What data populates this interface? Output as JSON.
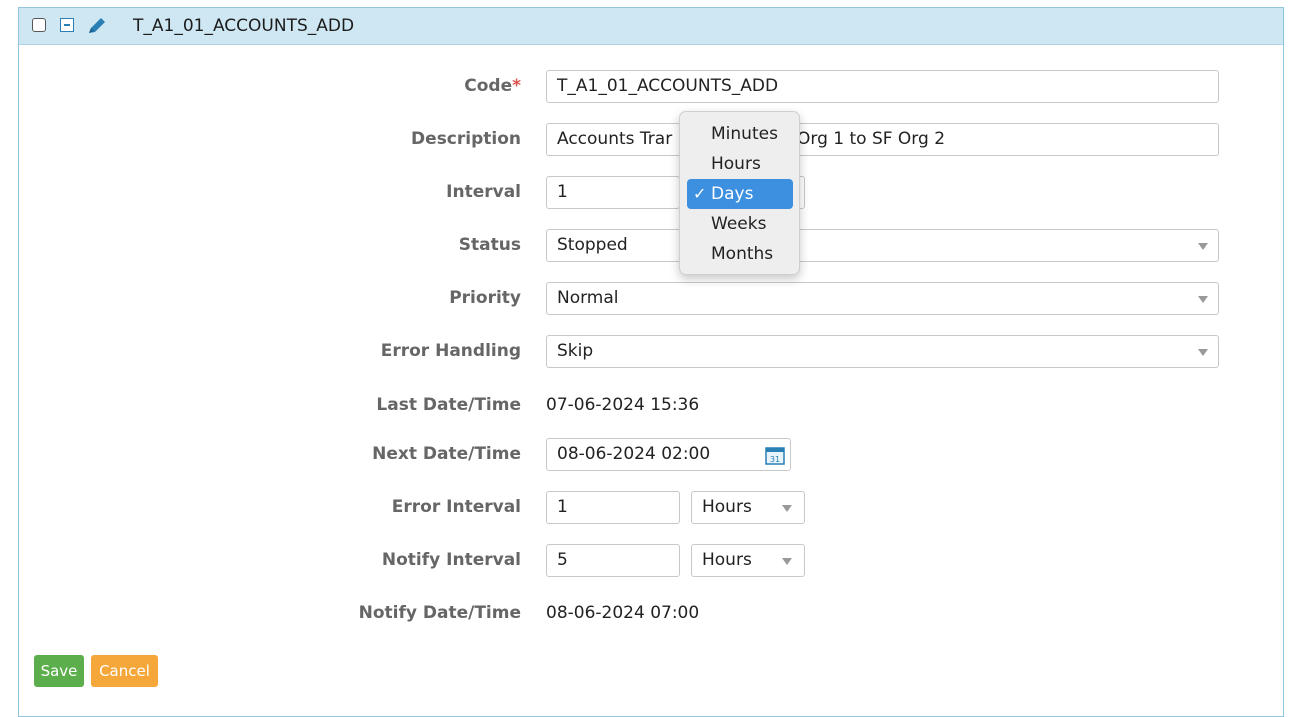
{
  "header": {
    "title": "T_A1_01_ACCOUNTS_ADD"
  },
  "form": {
    "code": {
      "label": "Code",
      "required_mark": "*",
      "value": "T_A1_01_ACCOUNTS_ADD"
    },
    "description": {
      "label": "Description",
      "value_left": "Accounts Trar",
      "value_right": "Org 1 to SF Org 2"
    },
    "interval": {
      "label": "Interval",
      "value": "1"
    },
    "status": {
      "label": "Status",
      "value": "Stopped"
    },
    "priority": {
      "label": "Priority",
      "value": "Normal"
    },
    "error_handling": {
      "label": "Error Handling",
      "value": "Skip"
    },
    "last_datetime": {
      "label": "Last Date/Time",
      "value": "07-06-2024 15:36"
    },
    "next_datetime": {
      "label": "Next Date/Time",
      "value": "08-06-2024 02:00",
      "calendar_day": "31"
    },
    "error_interval": {
      "label": "Error Interval",
      "value": "1",
      "unit": "Hours"
    },
    "notify_interval": {
      "label": "Notify Interval",
      "value": "5",
      "unit": "Hours"
    },
    "notify_datetime": {
      "label": "Notify Date/Time",
      "value": "08-06-2024 07:00"
    }
  },
  "buttons": {
    "save": "Save",
    "cancel": "Cancel"
  },
  "interval_unit_dropdown": {
    "options": [
      "Minutes",
      "Hours",
      "Days",
      "Weeks",
      "Months"
    ],
    "selected": "Days",
    "check_mark": "✓"
  },
  "colors": {
    "header_bg": "#cfe7f2",
    "save_bg": "#5cae4c",
    "cancel_bg": "#f5a73a",
    "selected_option_bg": "#3d8fe0",
    "required_mark": "#d9534f"
  }
}
